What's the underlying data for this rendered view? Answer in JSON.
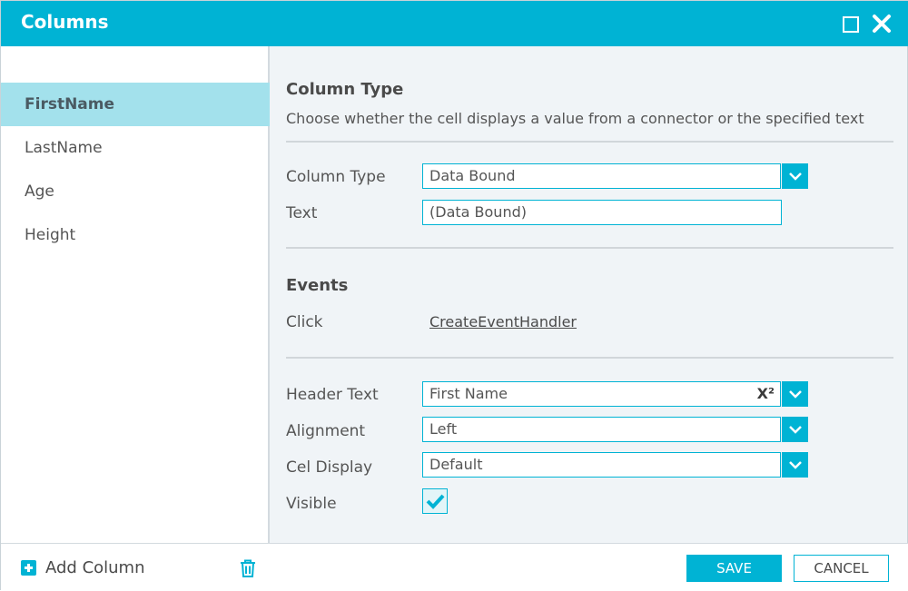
{
  "window": {
    "title": "Columns",
    "maximize_icon": "maximize-icon",
    "close_icon": "close-icon"
  },
  "sidebar": {
    "items": [
      {
        "label": "FirstName",
        "selected": true
      },
      {
        "label": "LastName",
        "selected": false
      },
      {
        "label": "Age",
        "selected": false
      },
      {
        "label": "Height",
        "selected": false
      }
    ]
  },
  "column_type_section": {
    "title": "Column Type",
    "description": "Choose whether the cell displays a value from a connector or the specified text",
    "column_type_label": "Column Type",
    "column_type_value": "Data Bound",
    "text_label": "Text",
    "text_value": "(Data Bound)"
  },
  "events_section": {
    "title": "Events",
    "click_label": "Click",
    "click_link": "CreateEventHandler"
  },
  "props_section": {
    "header_text_label": "Header Text",
    "header_text_value": "First Name",
    "header_text_badge": "X²",
    "alignment_label": "Alignment",
    "alignment_value": "Left",
    "cell_display_label": "Cel Display",
    "cell_display_value": "Default",
    "visible_label": "Visible",
    "visible_checked": true
  },
  "footer": {
    "add_column_label": "Add Column",
    "save_label": "SAVE",
    "cancel_label": "CANCEL"
  },
  "colors": {
    "accent": "#00b3d4",
    "selected_row": "#a3e1ec",
    "panel_bg": "#f0f4f7"
  }
}
